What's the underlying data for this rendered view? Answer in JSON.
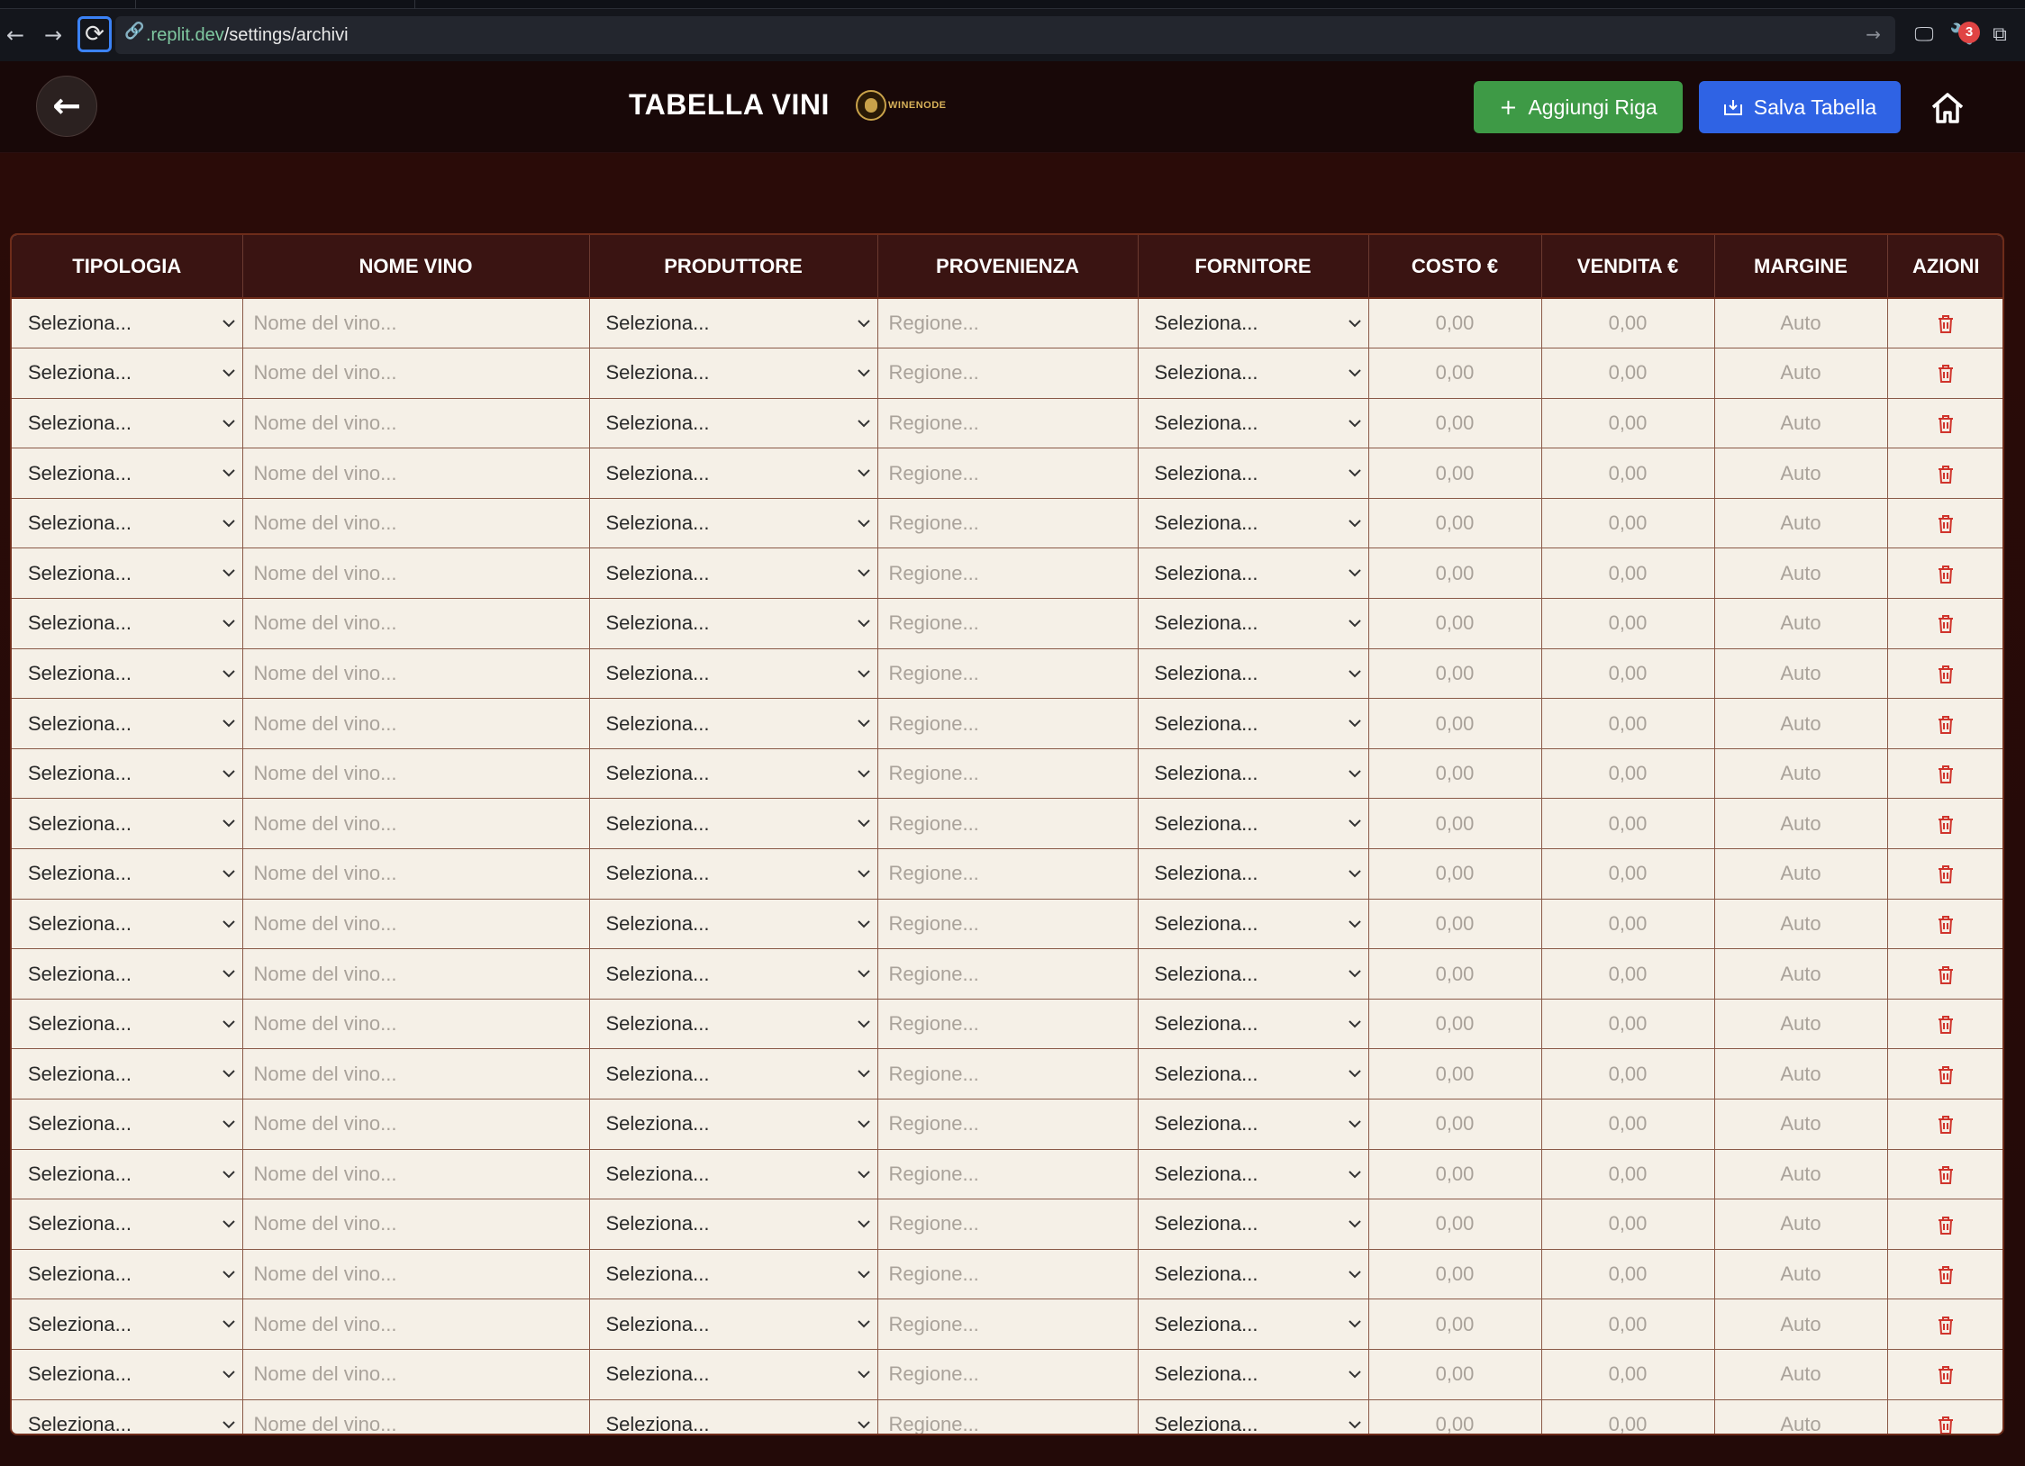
{
  "browser": {
    "url_host": ".replit.dev",
    "url_path": "/settings/archivi",
    "notification_count": "3"
  },
  "header": {
    "title": "TABELLA VINI",
    "logo_text": "WINENODE",
    "add_row_label": "Aggiungi Riga",
    "save_table_label": "Salva Tabella"
  },
  "table": {
    "columns": [
      "TIPOLOGIA",
      "NOME VINO",
      "PRODUTTORE",
      "PROVENIENZA",
      "FORNITORE",
      "COSTO €",
      "VENDITA €",
      "MARGINE",
      "AZIONI"
    ],
    "row_count": 23,
    "row_template": {
      "tipologia": "Seleziona...",
      "nome_vino_placeholder": "Nome del vino...",
      "produttore": "Seleziona...",
      "provenienza_placeholder": "Regione...",
      "fornitore": "Seleziona...",
      "costo_placeholder": "0,00",
      "vendita_placeholder": "0,00",
      "margine": "Auto"
    }
  },
  "colors": {
    "header_bg": "#3a1412",
    "row_bg": "#f5f0e7",
    "add_button": "#3e9a46",
    "save_button": "#2f63e4",
    "delete_icon": "#d0342c"
  },
  "icons": [
    "back-arrow-icon",
    "plus-icon",
    "save-icon",
    "home-icon",
    "chevron-down-icon",
    "trash-icon"
  ]
}
